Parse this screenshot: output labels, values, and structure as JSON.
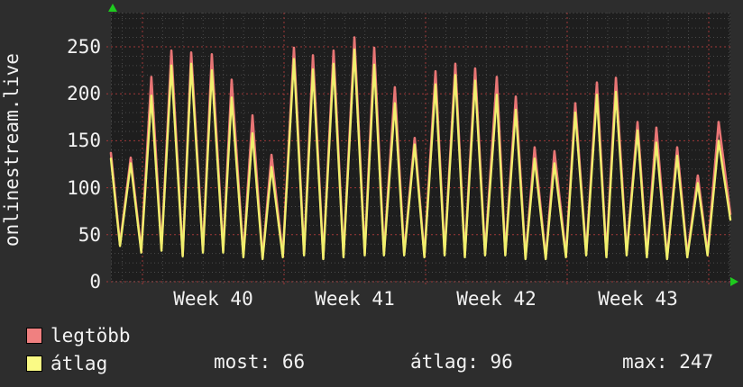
{
  "page": {
    "title_vertical": "onlinestream.live"
  },
  "colors": {
    "background": "#2d2d2d",
    "plot_background": "#1e1e1e",
    "grid_major": "#a03838",
    "grid_minor": "#4a4a4a",
    "plot_border": "#575757",
    "text": "#f2f2f2",
    "arrow": "#1ecb1e",
    "series_legtobb": "#e87575",
    "series_atlag": "#f0ef6d"
  },
  "legend": {
    "items": [
      {
        "id": "legtobb",
        "label": "legtöbb",
        "color": "#f08080"
      },
      {
        "id": "atlag",
        "label": "átlag",
        "color": "#fafa85"
      }
    ]
  },
  "stats": {
    "items": [
      {
        "label": "most",
        "value": 66,
        "text": "most: 66"
      },
      {
        "label": "átlag",
        "value": 96,
        "text": "átlag: 96"
      },
      {
        "label": "max",
        "value": 247,
        "text": "max: 247"
      }
    ]
  },
  "chart_data": {
    "type": "line",
    "title": "onlinestream.live",
    "x_unit": "days",
    "x_range_days": 30.63,
    "y_top": 286.4,
    "grid": true,
    "legend_position": "bottom-left",
    "y_axis": {
      "major_ticks": [
        0,
        50,
        100,
        150,
        200,
        250
      ],
      "minor_step": 10,
      "minor_max": 280
    },
    "x_axis": {
      "labels": [
        {
          "text": "Week 40",
          "day": 5.06
        },
        {
          "text": "Week 41",
          "day": 12.06
        },
        {
          "text": "Week 42",
          "day": 19.06
        },
        {
          "text": "Week 43",
          "day": 26.06
        }
      ],
      "week_lines_day": [
        1.56,
        8.56,
        15.56,
        22.56,
        29.56
      ],
      "day_lines": {
        "start": 0.56,
        "step": 1,
        "count": 31
      }
    },
    "series": [
      {
        "id": "legtobb",
        "name": "legtöbb",
        "color": "#e87575",
        "line_width": 2.6,
        "points": [
          [
            0,
            137
          ],
          [
            0.45,
            40
          ],
          [
            0.98,
            132
          ],
          [
            1.5,
            33
          ],
          [
            2,
            218
          ],
          [
            2.5,
            35
          ],
          [
            2.99,
            246
          ],
          [
            3.55,
            28
          ],
          [
            3.97,
            244
          ],
          [
            4.55,
            33
          ],
          [
            4.99,
            242
          ],
          [
            5.55,
            33
          ],
          [
            5.97,
            215
          ],
          [
            6.55,
            28
          ],
          [
            7,
            177
          ],
          [
            7.5,
            25
          ],
          [
            7.94,
            135
          ],
          [
            8.5,
            28
          ],
          [
            9.05,
            249
          ],
          [
            9.55,
            30
          ],
          [
            9.99,
            241
          ],
          [
            10.5,
            25
          ],
          [
            11.01,
            246
          ],
          [
            11.5,
            28
          ],
          [
            12.04,
            260
          ],
          [
            12.55,
            30
          ],
          [
            13.02,
            249
          ],
          [
            13.5,
            30
          ],
          [
            14.04,
            207
          ],
          [
            14.5,
            30
          ],
          [
            15.02,
            153
          ],
          [
            15.5,
            28
          ],
          [
            16.05,
            224
          ],
          [
            16.5,
            30
          ],
          [
            17.03,
            232
          ],
          [
            17.5,
            28
          ],
          [
            18.01,
            227
          ],
          [
            18.5,
            30
          ],
          [
            19.08,
            218
          ],
          [
            19.5,
            30
          ],
          [
            20.02,
            197
          ],
          [
            20.5,
            25
          ],
          [
            20.95,
            143
          ],
          [
            21.5,
            25
          ],
          [
            21.93,
            139
          ],
          [
            22.5,
            28
          ],
          [
            22.96,
            190
          ],
          [
            23.5,
            30
          ],
          [
            24.03,
            212
          ],
          [
            24.5,
            28
          ],
          [
            24.97,
            217
          ],
          [
            25.5,
            30
          ],
          [
            26.04,
            170
          ],
          [
            26.5,
            28
          ],
          [
            26.97,
            164
          ],
          [
            27.5,
            25
          ],
          [
            28,
            143
          ],
          [
            28.5,
            28
          ],
          [
            29.02,
            113
          ],
          [
            29.5,
            30
          ],
          [
            30.05,
            170
          ],
          [
            30.63,
            72
          ]
        ]
      },
      {
        "id": "atlag",
        "name": "átlag",
        "color": "#f0ef6d",
        "line_width": 2.4,
        "points": [
          [
            0,
            131
          ],
          [
            0.45,
            38
          ],
          [
            0.98,
            126
          ],
          [
            1.5,
            31
          ],
          [
            2,
            198
          ],
          [
            2.5,
            33
          ],
          [
            2.99,
            230
          ],
          [
            3.55,
            27
          ],
          [
            3.97,
            232
          ],
          [
            4.55,
            31
          ],
          [
            4.99,
            225
          ],
          [
            5.55,
            31
          ],
          [
            5.97,
            196
          ],
          [
            6.55,
            26
          ],
          [
            7,
            158
          ],
          [
            7.5,
            24
          ],
          [
            7.94,
            122
          ],
          [
            8.5,
            26
          ],
          [
            9.05,
            237
          ],
          [
            9.55,
            28
          ],
          [
            9.99,
            226
          ],
          [
            10.5,
            24
          ],
          [
            11.01,
            232
          ],
          [
            11.5,
            26
          ],
          [
            12.04,
            247
          ],
          [
            12.55,
            28
          ],
          [
            13.02,
            231
          ],
          [
            13.5,
            28
          ],
          [
            14.04,
            190
          ],
          [
            14.5,
            28
          ],
          [
            15.02,
            146
          ],
          [
            15.5,
            26
          ],
          [
            16.05,
            210
          ],
          [
            16.5,
            28
          ],
          [
            17.03,
            220
          ],
          [
            17.5,
            26
          ],
          [
            18.01,
            214
          ],
          [
            18.5,
            28
          ],
          [
            19.08,
            199
          ],
          [
            19.5,
            28
          ],
          [
            20.02,
            183
          ],
          [
            20.5,
            24
          ],
          [
            20.95,
            131
          ],
          [
            21.5,
            24
          ],
          [
            21.93,
            126
          ],
          [
            22.5,
            26
          ],
          [
            22.96,
            180
          ],
          [
            23.5,
            28
          ],
          [
            24.03,
            199
          ],
          [
            24.5,
            26
          ],
          [
            24.97,
            202
          ],
          [
            25.5,
            28
          ],
          [
            26.04,
            161
          ],
          [
            26.5,
            26
          ],
          [
            26.97,
            148
          ],
          [
            27.5,
            24
          ],
          [
            28,
            134
          ],
          [
            28.5,
            26
          ],
          [
            29.02,
            105
          ],
          [
            29.5,
            28
          ],
          [
            30.05,
            150
          ],
          [
            30.63,
            66
          ]
        ]
      }
    ]
  }
}
